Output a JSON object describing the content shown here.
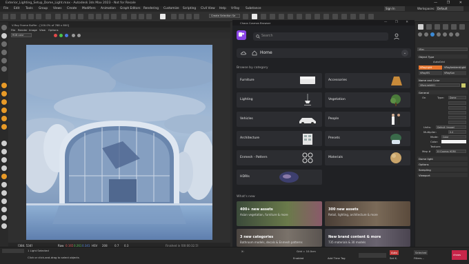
{
  "window": {
    "title": "Exterior_Lighting_Setup_Dome_Light.max - Autodesk 3ds Max 2023 - Not for Resale",
    "controls": "— ❐ ✕"
  },
  "menubar": {
    "items": [
      "File",
      "Edit",
      "Tools",
      "Group",
      "Views",
      "Create",
      "Modifiers",
      "Animation",
      "Graph Editors",
      "Rendering",
      "Customize",
      "Scripting",
      "Civil View",
      "Help",
      "V-Ray",
      "Substance"
    ],
    "sign_in": "Sign In",
    "workspaces_label": "Workspaces:",
    "workspace_value": "Default"
  },
  "toolbar": {
    "selection_set": "Create Selection Se"
  },
  "framebuffer": {
    "title": "V-Ray Frame Buffer - [100.0% of 768 x 800]",
    "menu": [
      "File",
      "Render",
      "Image",
      "View",
      "Options"
    ],
    "channel": "RGB color",
    "status": {
      "coords": "[384, 534]",
      "mode": "Raw",
      "r": "0.165",
      "g": "0.261",
      "b": "0.341",
      "h": "HSV",
      "v1": "208",
      "v2": "0.7",
      "v3": "0.3",
      "info": "Finished in [00:00:32.5]"
    }
  },
  "cosmos": {
    "title": "Chaos Cosmos Browser",
    "title_controls": "— ❐ ✕",
    "search_placeholder": "Search",
    "home_label": "Home",
    "browse_label": "Browse by category",
    "categories": [
      {
        "label": "Furniture"
      },
      {
        "label": "Accessories"
      },
      {
        "label": "Lighting"
      },
      {
        "label": "Vegetation"
      },
      {
        "label": "Vehicles"
      },
      {
        "label": "People"
      },
      {
        "label": "Architecture"
      },
      {
        "label": "Presets"
      },
      {
        "label": "Enmesh - Pattern"
      },
      {
        "label": "Materials"
      },
      {
        "label": "HDRIs"
      }
    ],
    "whats_new_label": "What's new",
    "news": [
      {
        "title": "400+ new assets",
        "subtitle": "Asian vegetation, furniture & more"
      },
      {
        "title": "300 new assets",
        "subtitle": "Retail, lighting, architecture & more"
      },
      {
        "title": "3 new categories",
        "subtitle": "Bathroom models, decals & Enmesh patterns"
      },
      {
        "title": "New brand content & more",
        "subtitle": "735 materials & 30 models"
      }
    ]
  },
  "command_panel": {
    "filter": "VRay",
    "object_type": "Object Type",
    "autogrid": "AutoGrid",
    "buttons": [
      "VRayLight",
      "VRayAmbientLight",
      "VRayIES",
      "VRaySun"
    ],
    "name_color": "Name and Color",
    "name_value": "VRayLight001",
    "general": "General",
    "on_label": "On",
    "type_label": "Type:",
    "type_value": "Dome",
    "units_label": "Units:",
    "units_value": "Default (image)",
    "multiplier_label": "Multiplier:",
    "multiplier_value": "0.4",
    "mode_label": "Mode:",
    "mode_value": "Color",
    "color_label": "Color:",
    "texture_label": "Texture:",
    "map_label": "Map #",
    "map_value": "8 (Cosmos HDRI)",
    "sections": [
      "Dome light",
      "Options",
      "Sampling",
      "Viewport"
    ]
  },
  "statusbar": {
    "selection": "1 Light Selected",
    "prompt": "Click or click-and-drag to select objects",
    "x_label": "X:",
    "x_value": "",
    "grid": "Grid = 10.0cm",
    "enabled": "Enabled",
    "add_time_tag": "Add Time Tag",
    "frame_value": "0",
    "auto_label": "Auto",
    "selected_label": "Selected",
    "set_k": "Set K.",
    "filters": "Filters...",
    "badge": "chaos"
  }
}
